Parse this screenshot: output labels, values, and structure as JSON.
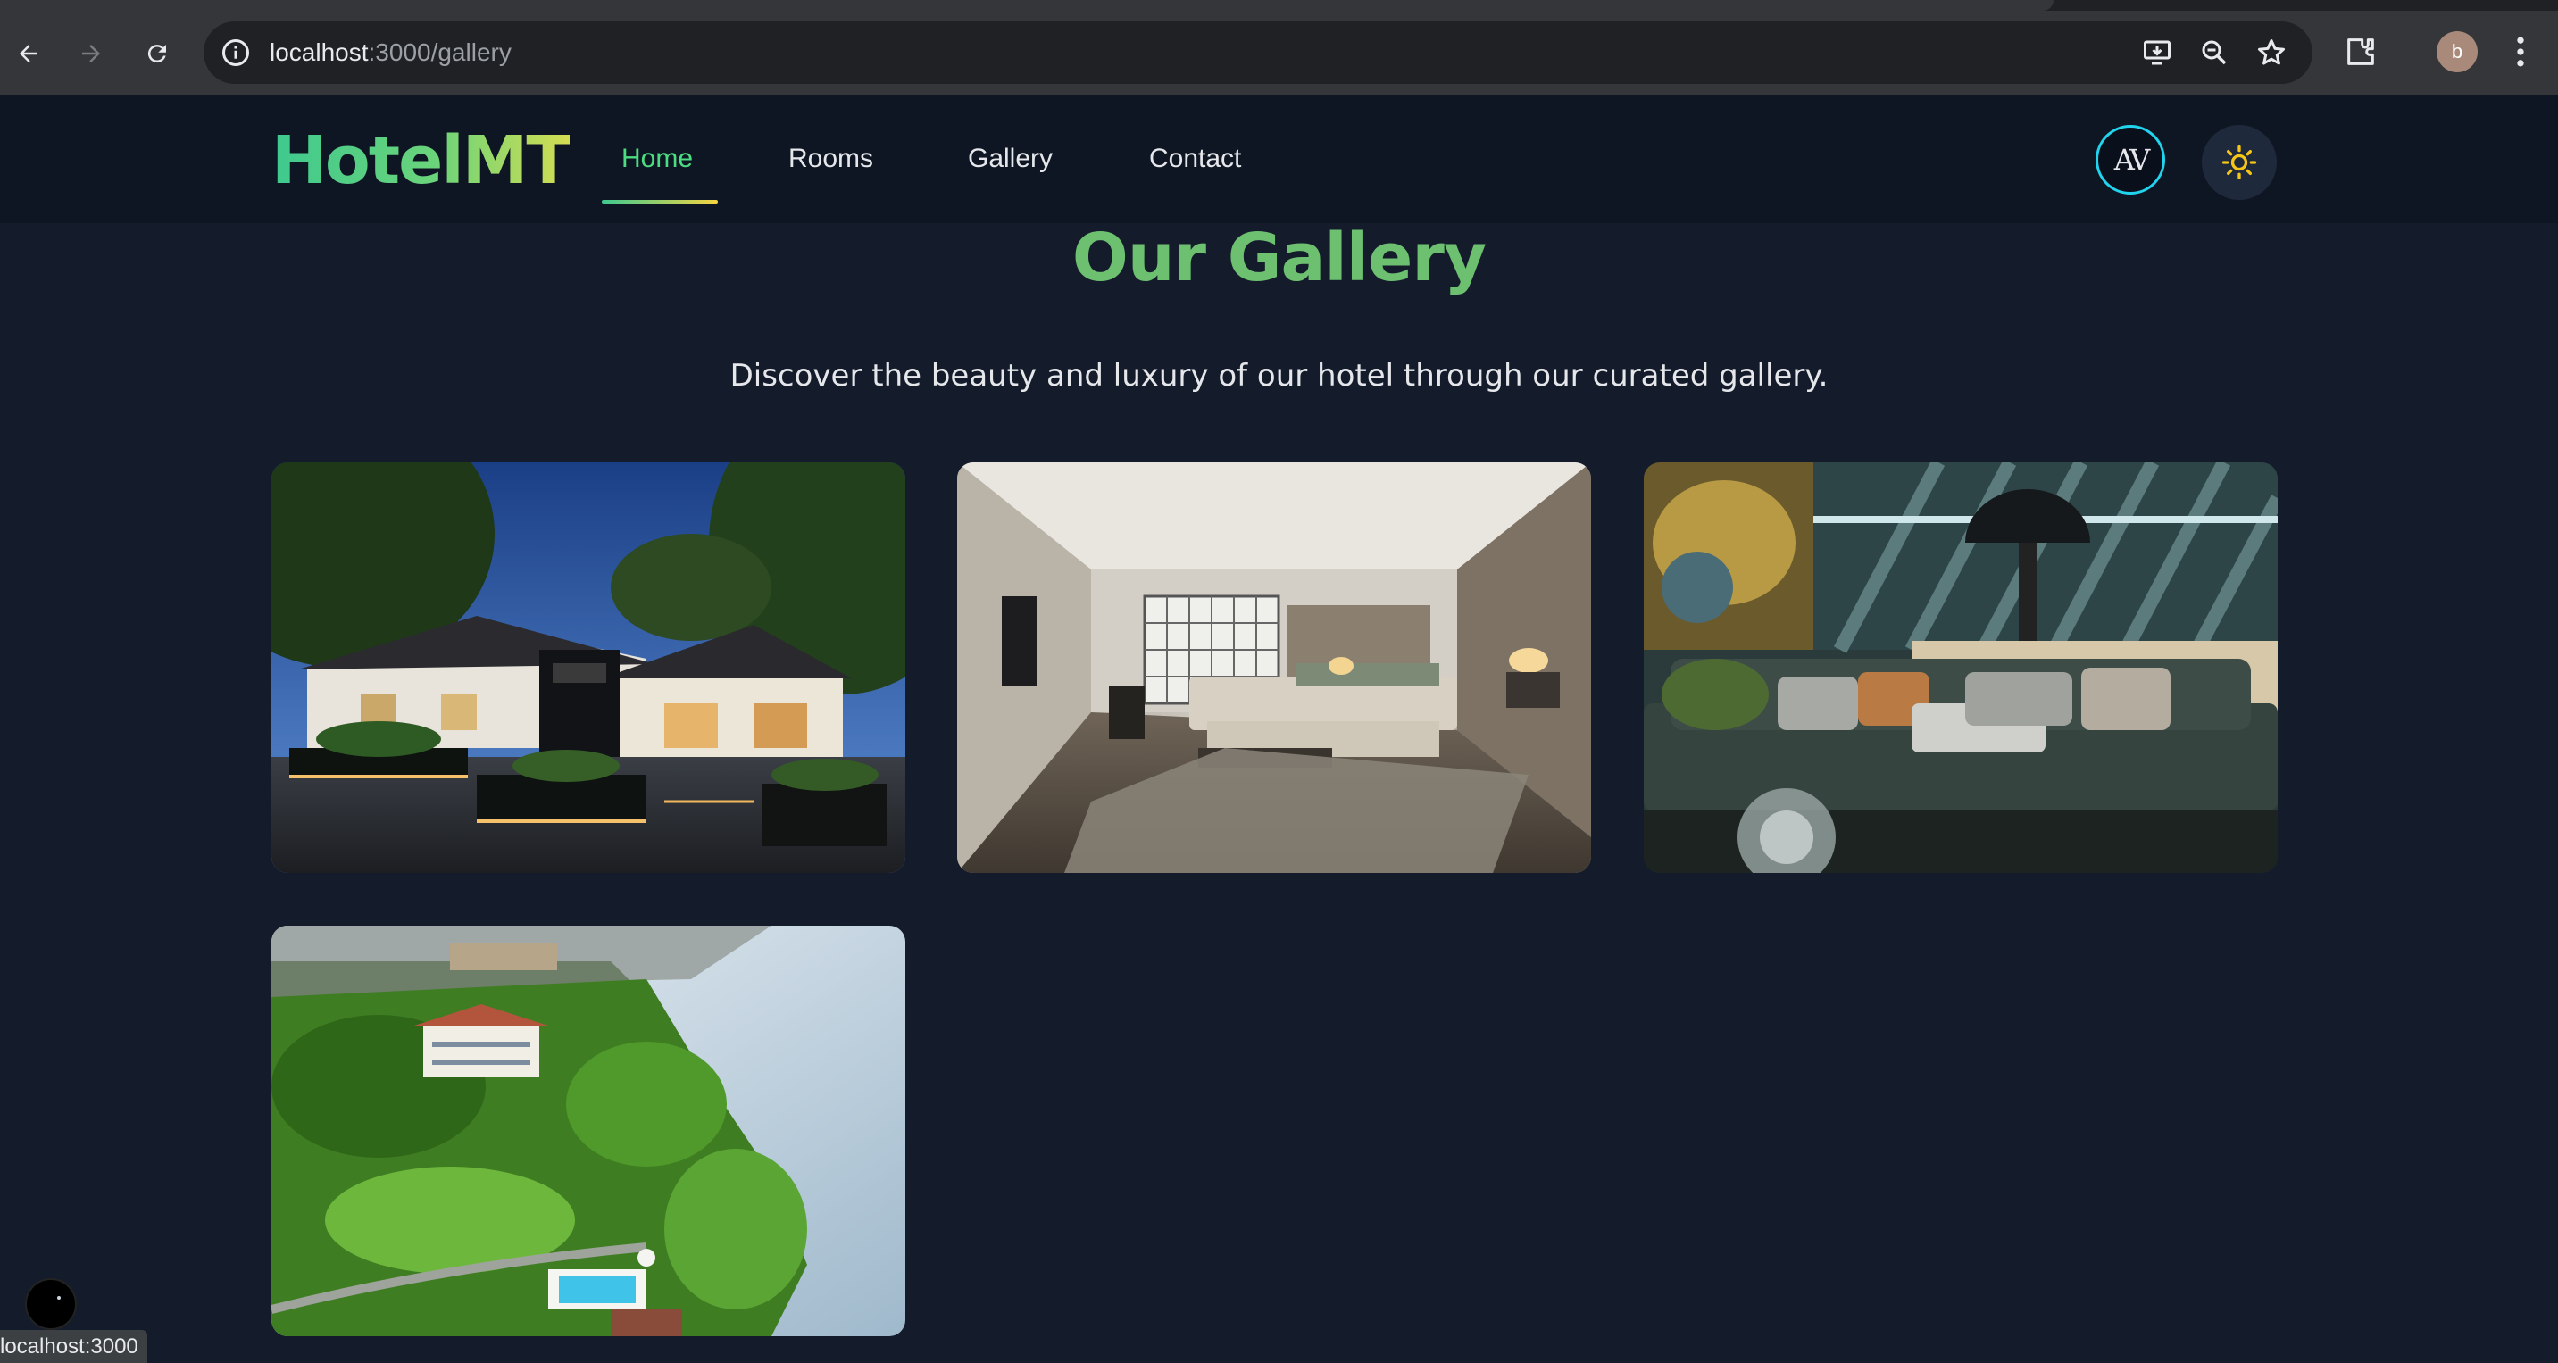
{
  "browser": {
    "url_host": "localhost",
    "url_path": ":3000/gallery",
    "profile_initial": "b",
    "status_text": "localhost:3000"
  },
  "header": {
    "brand": "HotelMT",
    "nav": [
      {
        "label": "Home",
        "active": true
      },
      {
        "label": "Rooms",
        "active": false
      },
      {
        "label": "Gallery",
        "active": false
      },
      {
        "label": "Contact",
        "active": false
      }
    ],
    "avatar_text": "AV",
    "theme_icon": "sun-icon"
  },
  "main": {
    "title": "Our Gallery",
    "subtitle": "Discover the beauty and luxury of our hotel through our curated gallery.",
    "images": [
      {
        "name": "hotel-exterior-night"
      },
      {
        "name": "hotel-bedroom"
      },
      {
        "name": "hotel-lounge"
      },
      {
        "name": "hotel-lakeside-aerial"
      }
    ]
  },
  "colors": {
    "accent_green": "#4ade80",
    "title_green": "#6cc070",
    "cyan_ring": "#22d3ee",
    "sun_yellow": "#f5c518",
    "background": "#141c2b"
  }
}
